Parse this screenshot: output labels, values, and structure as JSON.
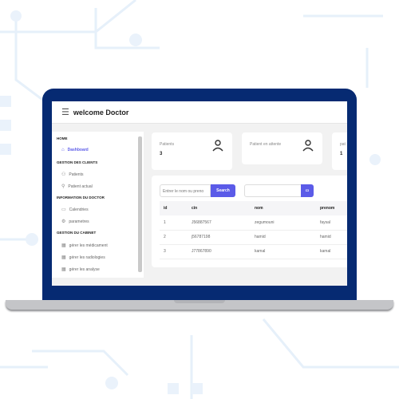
{
  "header": {
    "title": "welcome Doctor",
    "menu_icon": "☰"
  },
  "sidebar": {
    "sections": [
      {
        "title": "HOME",
        "items": [
          {
            "label": "Dashboard",
            "icon": "⌂",
            "active": true
          }
        ]
      },
      {
        "title": "GESTION DES CLIENTS",
        "items": [
          {
            "label": "Patients",
            "icon": "⚇"
          },
          {
            "label": "Patient actual",
            "icon": "⚲"
          }
        ]
      },
      {
        "title": "INFORMATION DU DOCTOR",
        "items": [
          {
            "label": "Calendries",
            "icon": "▭"
          },
          {
            "label": "parametres",
            "icon": "⚙"
          }
        ]
      },
      {
        "title": "GESTION DU CABINET",
        "items": [
          {
            "label": "gérer les médicament",
            "icon": "▦"
          },
          {
            "label": "gérer les radiologies",
            "icon": "▦"
          },
          {
            "label": "gérer les analyse",
            "icon": "▦"
          }
        ]
      }
    ]
  },
  "cards": [
    {
      "label": "Patients",
      "value": "3"
    },
    {
      "label": "Patient en attente",
      "value": ""
    },
    {
      "label": "pat",
      "value": "1"
    }
  ],
  "search": {
    "placeholder": "Entrer le nom ou preno",
    "button": "Search",
    "date_icon": "▭"
  },
  "table": {
    "headers": [
      "id",
      "cin",
      "nom",
      "prenom"
    ],
    "rows": [
      [
        "1",
        "J56887567",
        "zegumouni",
        "faysal"
      ],
      [
        "2",
        "j56787198",
        "hamid",
        "hamid"
      ],
      [
        "3",
        "J77867890",
        "kamal",
        "kamal"
      ]
    ]
  },
  "colors": {
    "accent": "#5b5be8",
    "frame": "#062a72"
  }
}
